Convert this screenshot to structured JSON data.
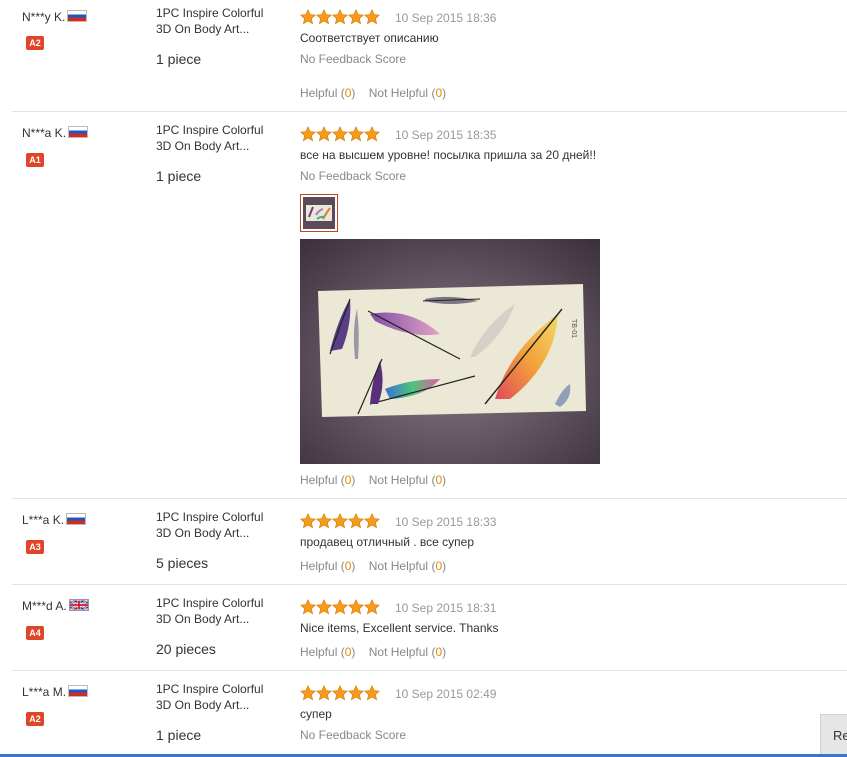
{
  "reviews": [
    {
      "buyer": "N***y K.",
      "flag": "ru",
      "level": "A2",
      "product": "1PC Inspire Colorful 3D On Body Art...",
      "quantity": "1 piece",
      "rating": 5,
      "date": "10 Sep 2015 18:36",
      "text": "Соответствует описанию",
      "feedback_score": "No Feedback Score",
      "helpful_label": "Helpful",
      "helpful_count": "0",
      "not_helpful_label": "Not Helpful",
      "not_helpful_count": "0"
    },
    {
      "buyer": "N***a K.",
      "flag": "ru",
      "level": "A1",
      "product": "1PC Inspire Colorful 3D On Body Art...",
      "quantity": "1 piece",
      "rating": 5,
      "date": "10 Sep 2015 18:35",
      "text": "все на высшем уровне! посылка пришла за 20 дней!!",
      "feedback_score": "No Feedback Score",
      "helpful_label": "Helpful",
      "helpful_count": "0",
      "not_helpful_label": "Not Helpful",
      "not_helpful_count": "0"
    },
    {
      "buyer": "L***a K.",
      "flag": "ru",
      "level": "A3",
      "product": "1PC Inspire Colorful 3D On Body Art...",
      "quantity": "5 pieces",
      "rating": 5,
      "date": "10 Sep 2015 18:33",
      "text": "продавец отличный . все супер",
      "helpful_label": "Helpful",
      "helpful_count": "0",
      "not_helpful_label": "Not Helpful",
      "not_helpful_count": "0"
    },
    {
      "buyer": "M***d A.",
      "flag": "uk",
      "level": "A4",
      "product": "1PC Inspire Colorful 3D On Body Art...",
      "quantity": "20 pieces",
      "rating": 5,
      "date": "10 Sep 2015 18:31",
      "text": "Nice items, Excellent service. Thanks",
      "helpful_label": "Helpful",
      "helpful_count": "0",
      "not_helpful_label": "Not Helpful",
      "not_helpful_count": "0"
    },
    {
      "buyer": "L***a M.",
      "flag": "ru",
      "level": "A2",
      "product": "1PC Inspire Colorful 3D On Body Art...",
      "quantity": "1 piece",
      "rating": 5,
      "date": "10 Sep 2015 02:49",
      "text": "супер",
      "feedback_score": "No Feedback Score"
    }
  ],
  "side_button_label": "Re",
  "colors": {
    "star": "#f59a1b",
    "level_badge": "#e0452a",
    "count": "#e08a00",
    "bottom_bar": "#3a78c2"
  }
}
